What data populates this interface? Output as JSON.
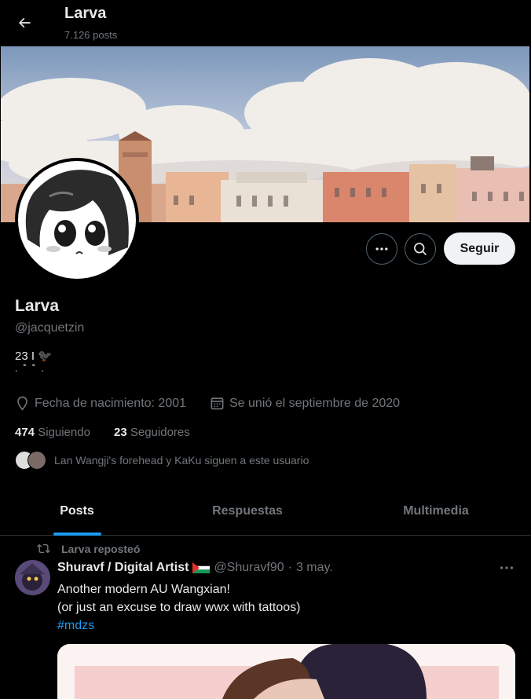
{
  "header": {
    "title": "Larva",
    "posts_count": "7.126 posts"
  },
  "profile": {
    "name": "Larva",
    "handle": "@jacquetzin",
    "bio_line1": "23  I        🐦‍⬛",
    "bio_line2": ". ˚ ˚     .",
    "birthday": "Fecha de nacimiento: 2001",
    "joined": "Se unió el septiembre de 2020",
    "following_count": "474",
    "following_label": "Siguiendo",
    "followers_count": "23",
    "followers_label": "Seguidores",
    "known_followers": "Lan Wangji's forehead y KaKu siguen a este usuario",
    "follow_button": "Seguir"
  },
  "tabs": [
    {
      "label": "Posts",
      "active": true
    },
    {
      "label": "Respuestas",
      "active": false
    },
    {
      "label": "Multimedia",
      "active": false
    }
  ],
  "post": {
    "repost_label": "Larva reposteó",
    "author_name": "Shuravf / Digital Artist",
    "author_handle": "@Shuravf90",
    "dot": "·",
    "date": "3 may.",
    "line1": "Another modern AU Wangxian!",
    "line2": "(or just an excuse to draw wwx with tattoos)",
    "hashtag": "#mdzs"
  },
  "colors": {
    "accent": "#1d9bf0",
    "background": "#000000",
    "muted": "#71767b"
  },
  "icons": [
    "back-arrow-icon",
    "more-icon",
    "search-icon",
    "location-icon",
    "calendar-icon",
    "repost-icon",
    "flag-icon"
  ]
}
